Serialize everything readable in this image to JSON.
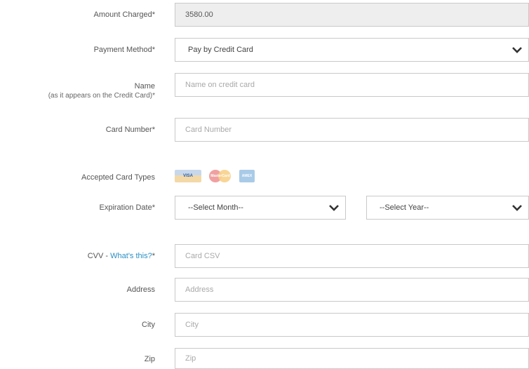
{
  "form": {
    "amount": {
      "label": "Amount Charged*",
      "value": "3580.00"
    },
    "payment_method": {
      "label": "Payment Method*",
      "value": "Pay by Credit Card"
    },
    "name": {
      "label": "Name",
      "sublabel": "(as it appears on the Credit Card)*",
      "placeholder": "Name on credit card"
    },
    "card_number": {
      "label": "Card Number*",
      "placeholder": "Card Number"
    },
    "accepted_cards": {
      "label": "Accepted Card Types",
      "cards": [
        "VISA",
        "MasterCard",
        "AMEX"
      ]
    },
    "expiration": {
      "label": "Expiration Date*",
      "month_value": "--Select Month--",
      "year_value": "--Select Year--"
    },
    "cvv": {
      "label_prefix": "CVV - ",
      "label_link": "What's this?",
      "label_suffix": "*",
      "placeholder": "Card CSV"
    },
    "address": {
      "label": "Address",
      "placeholder": "Address"
    },
    "city": {
      "label": "City",
      "placeholder": "City"
    },
    "zip": {
      "label": "Zip",
      "placeholder": "Zip"
    }
  },
  "icons": {
    "chevron": "chevron-down-icon"
  },
  "colors": {
    "link": "#2a8fc4",
    "border": "#c9c9c9",
    "readonly_bg": "#eeeeee"
  }
}
